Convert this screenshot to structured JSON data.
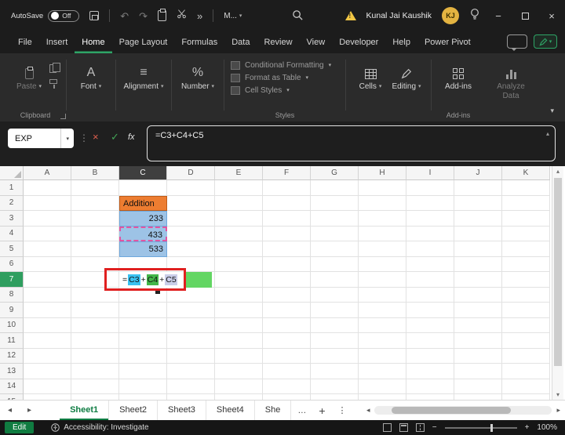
{
  "titlebar": {
    "autosave_label": "AutoSave",
    "autosave_state": "Off",
    "more_menu_label": "M...",
    "user_name": "Kunal Jai Kaushik",
    "user_initials": "KJ"
  },
  "menubar": {
    "items": [
      "File",
      "Insert",
      "Home",
      "Page Layout",
      "Formulas",
      "Data",
      "Review",
      "View",
      "Developer",
      "Help",
      "Power Pivot"
    ],
    "active_item": "Home"
  },
  "ribbon": {
    "paste_label": "Paste",
    "font_label": "Font",
    "alignment_label": "Alignment",
    "number_label": "Number",
    "styles_items": [
      "Conditional Formatting",
      "Format as Table",
      "Cell Styles"
    ],
    "cells_label": "Cells",
    "editing_label": "Editing",
    "addins_label": "Add-ins",
    "analyze_label": "Analyze Data",
    "group_clipboard": "Clipboard",
    "group_styles": "Styles",
    "group_addins": "Add-ins"
  },
  "formula_bar": {
    "name_box_value": "EXP",
    "fx_label": "fx",
    "formula": "=C3+C4+C5"
  },
  "grid": {
    "columns": [
      "A",
      "B",
      "C",
      "D",
      "E",
      "F",
      "G",
      "H",
      "I",
      "J",
      "K"
    ],
    "row_count": 15,
    "selected_column": "C",
    "selected_row": "7",
    "cells": [
      {
        "ref": "C2",
        "text": "Addition",
        "bg": "#ED7D31",
        "align": "left",
        "border": "#BF5B17"
      },
      {
        "ref": "C3",
        "text": "233",
        "bg": "#9DC3E6",
        "align": "right",
        "border": "#6FA8DC"
      },
      {
        "ref": "C4",
        "text": "433",
        "bg": "#9DC3E6",
        "align": "right",
        "dashed_border": "#E255A1"
      },
      {
        "ref": "C5",
        "text": "533",
        "bg": "#9DC3E6",
        "align": "right",
        "border": "#6FA8DC"
      }
    ],
    "edit_cell": {
      "ref": "C7",
      "segments": [
        {
          "text": "="
        },
        {
          "text": "C3",
          "bg": "#39C1F0"
        },
        {
          "text": "+"
        },
        {
          "text": "C4",
          "bg": "#43B649"
        },
        {
          "text": "+"
        },
        {
          "text": "C5",
          "bg": "#C9CDE8"
        }
      ],
      "overflow_color": "#63D663",
      "annotation_color": "#E02020"
    }
  },
  "sheetbar": {
    "tabs": [
      "Sheet1",
      "Sheet2",
      "Sheet3",
      "Sheet4",
      "She"
    ],
    "active_tab": "Sheet1"
  },
  "statusbar": {
    "mode": "Edit",
    "accessibility_label": "Accessibility: Investigate",
    "zoom_value": "100%"
  },
  "icons": {
    "undo_glyph": "↶",
    "redo_glyph": "↷",
    "overflow_glyph": "»",
    "dropdown_caret": "▾",
    "up_caret": "▴",
    "dots_vertical": "⋮",
    "check_glyph": "✓",
    "cancel_glyph": "×",
    "close_glyph": "×",
    "minimize_glyph": "−",
    "ellipsis_glyph": "…",
    "arrow_left_glyph": "◂",
    "arrow_right_glyph": "▸",
    "alignment_glyph": "≡",
    "percent_glyph": "%",
    "font_glyph": "A",
    "plus_glyph": "+",
    "minus_glyph": "−"
  }
}
